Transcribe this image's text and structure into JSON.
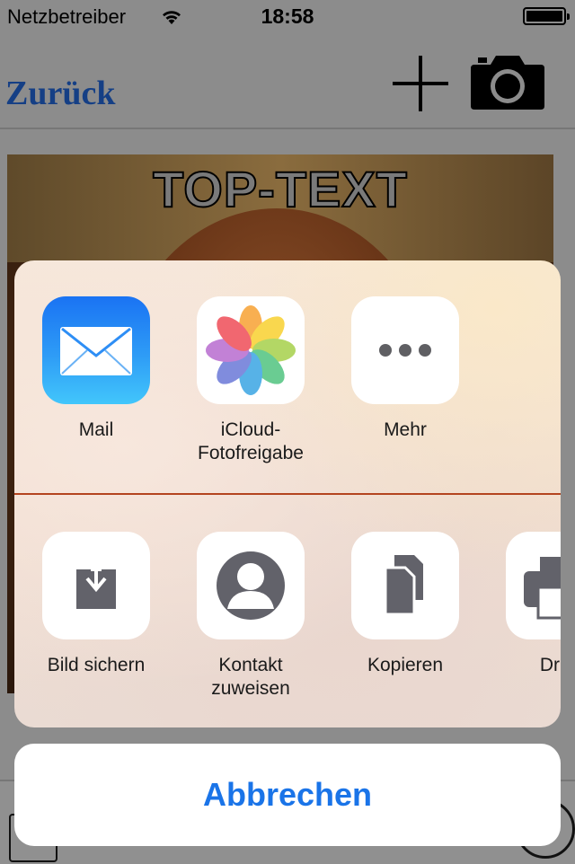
{
  "status_bar": {
    "carrier": "Netzbetreiber",
    "time": "18:58"
  },
  "nav": {
    "back_label": "Zurück",
    "add_icon": "plus-icon",
    "camera_icon": "camera-icon"
  },
  "photo": {
    "top_text": "TOP-TEXT"
  },
  "share_sheet": {
    "apps": [
      {
        "label": "Mail",
        "icon": "mail-icon"
      },
      {
        "label": "iCloud-\nFotofreigabe",
        "icon": "photos-icon"
      },
      {
        "label": "Mehr",
        "icon": "more-icon"
      }
    ],
    "actions": [
      {
        "label": "Bild sichern",
        "icon": "save-image-icon"
      },
      {
        "label": "Kontakt\nzuweisen",
        "icon": "assign-contact-icon"
      },
      {
        "label": "Kopieren",
        "icon": "copy-icon"
      },
      {
        "label": "Druc",
        "icon": "print-icon"
      }
    ],
    "cancel_label": "Abbrechen"
  },
  "colors": {
    "accent": "#1a74e8",
    "back_link": "#153f85",
    "divider": "#b4441f"
  }
}
